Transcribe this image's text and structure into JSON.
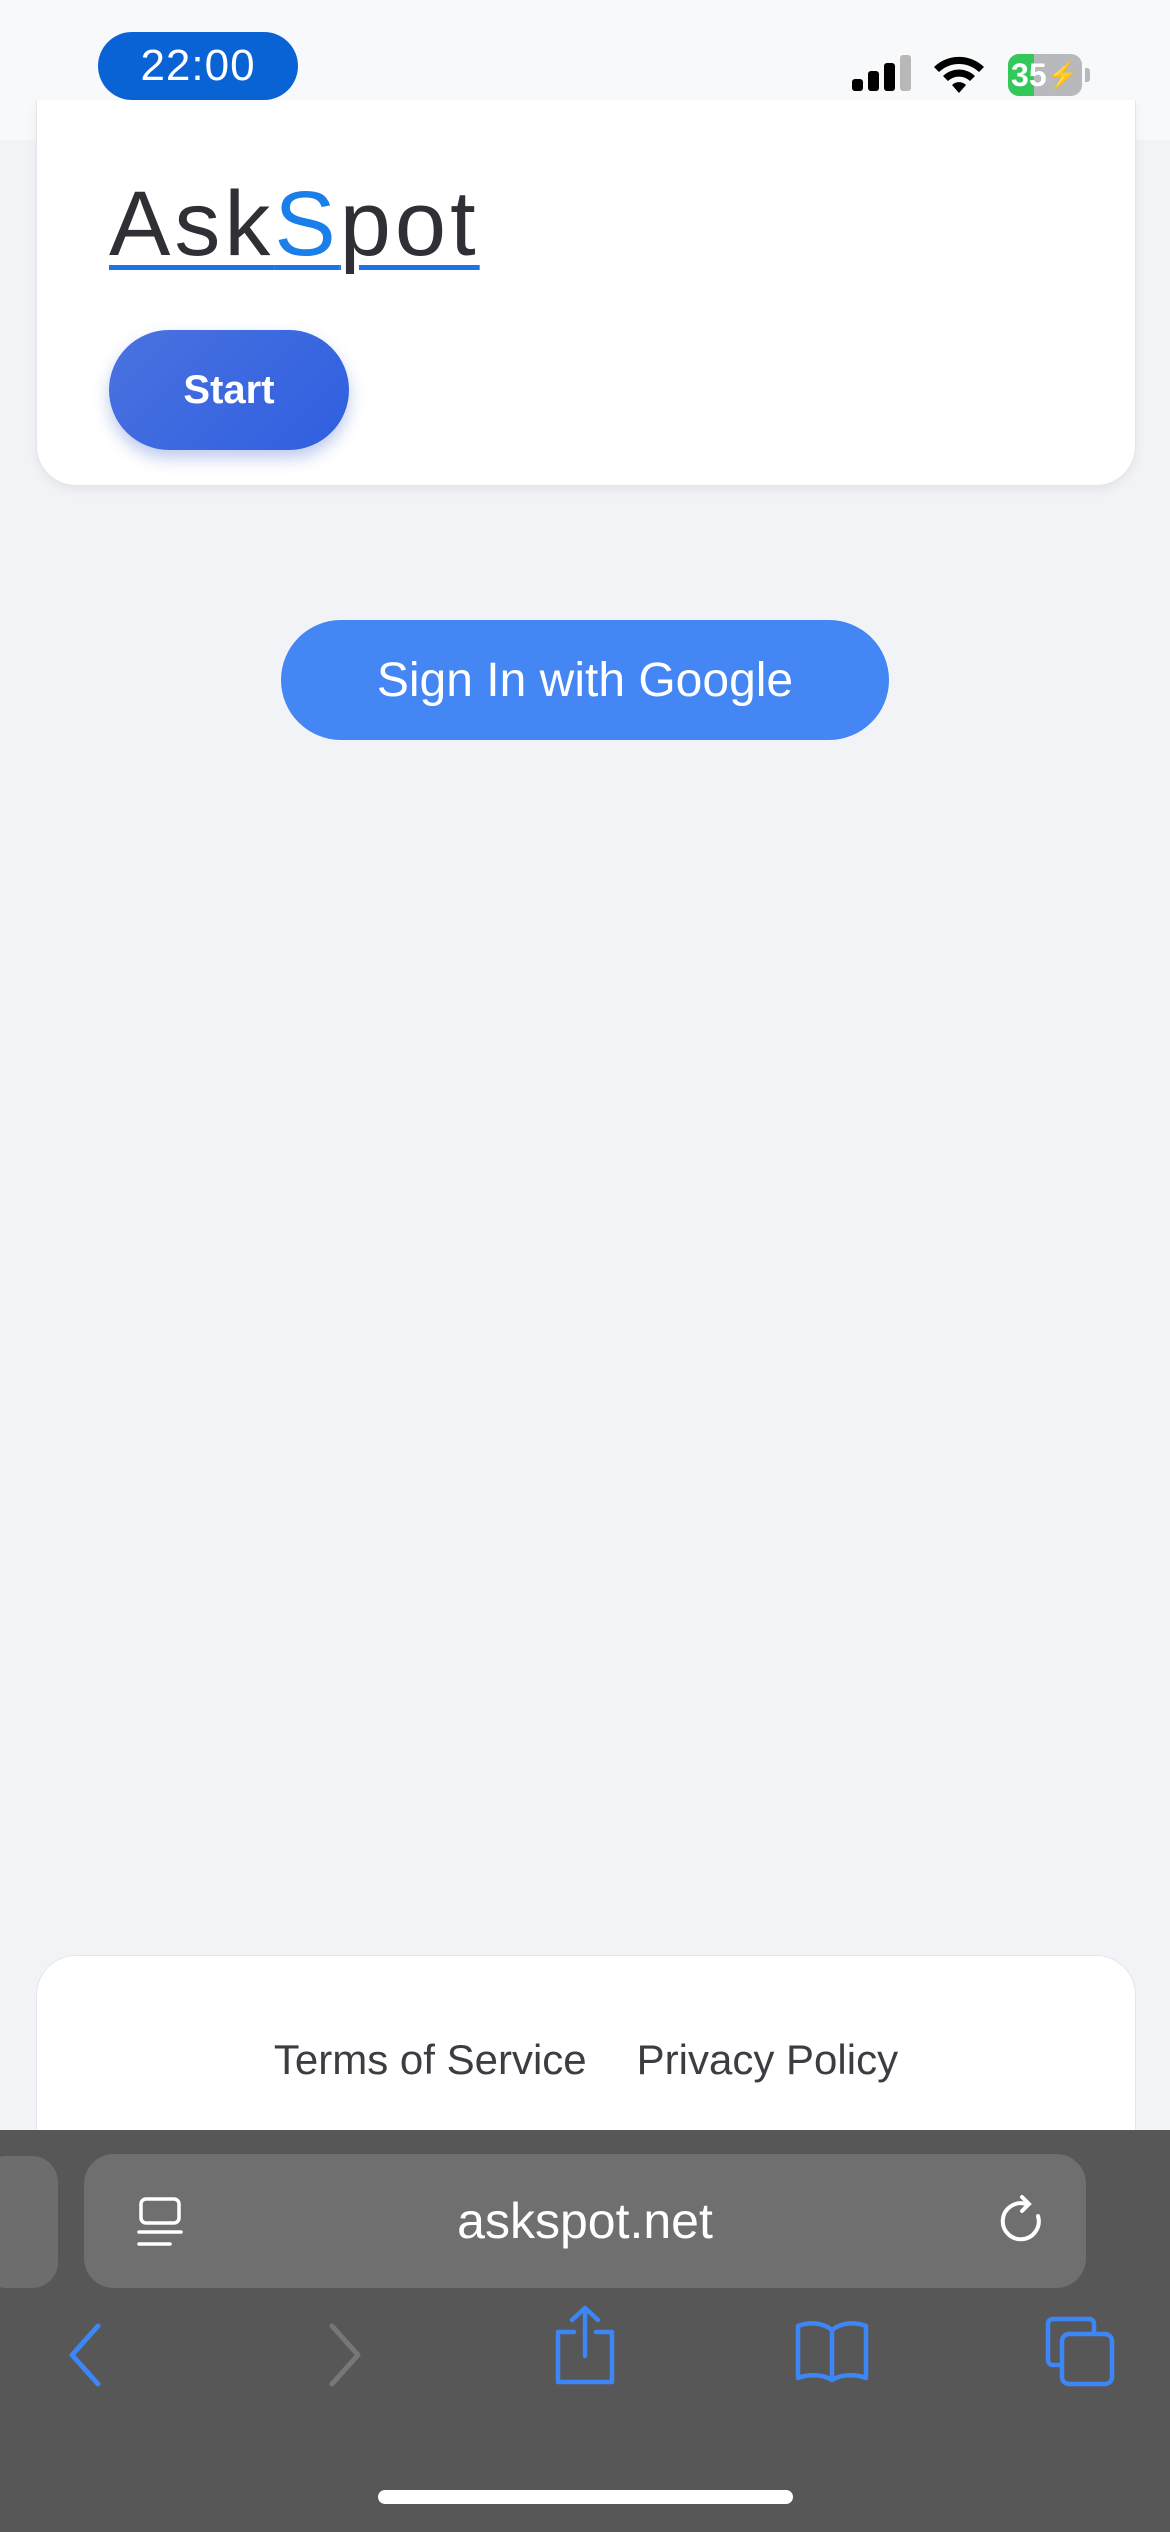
{
  "status_bar": {
    "time": "22:00",
    "battery_level": "35",
    "icons": [
      "cellular-signal-icon",
      "wifi-icon",
      "battery-charging-icon"
    ]
  },
  "header": {
    "logo_part1": "Ask",
    "logo_accent": "S",
    "logo_part2": "pot",
    "start_label": "Start"
  },
  "main": {
    "google_signin_label": "Sign In with Google"
  },
  "footer": {
    "terms_label": "Terms of Service",
    "privacy_label": "Privacy Policy"
  },
  "browser": {
    "url": "askspot.net",
    "icons": [
      "reader-icon",
      "reload-icon",
      "back-icon",
      "forward-icon",
      "share-icon",
      "bookmarks-icon",
      "tabs-icon"
    ]
  },
  "colors": {
    "accent": "#1a73e8",
    "time_pill": "#0a63d4",
    "google_button": "#4487f4",
    "battery_fill": "#34c759",
    "toolbar": "#575757"
  }
}
